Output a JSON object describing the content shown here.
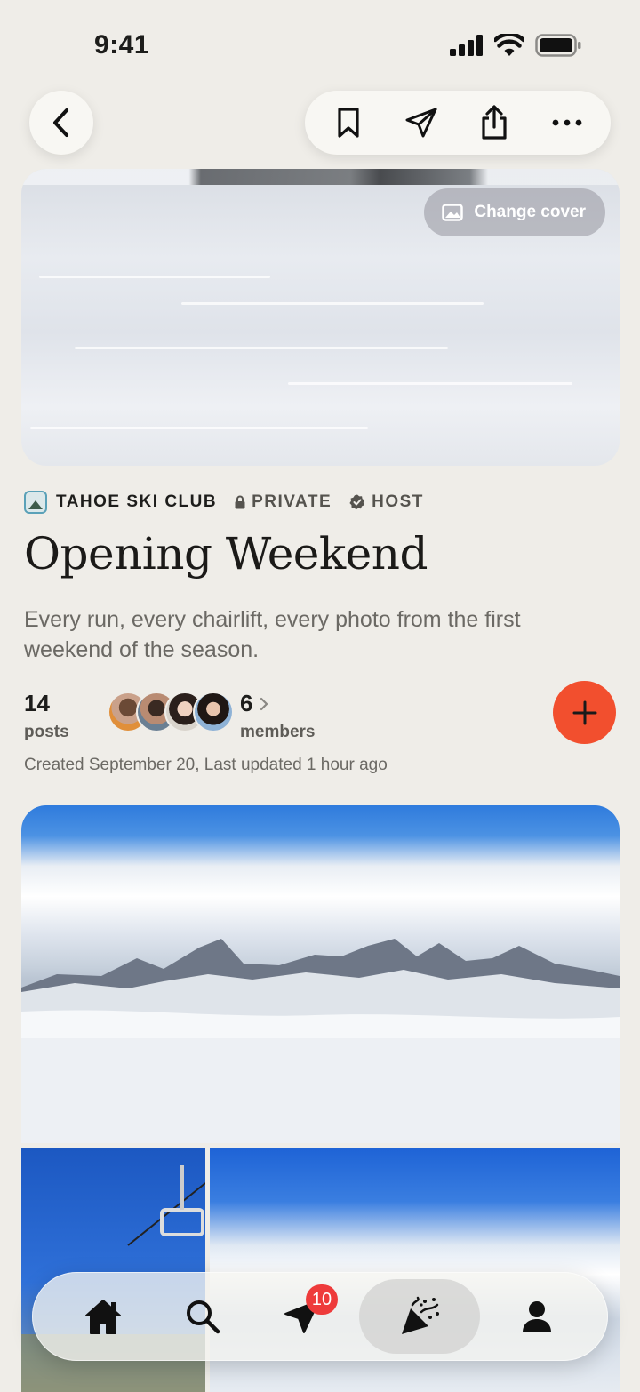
{
  "status_bar": {
    "time": "9:41"
  },
  "top_nav": {
    "back_icon": "chevron-left-icon",
    "actions": [
      "bookmark-icon",
      "send-icon",
      "share-icon",
      "more-icon"
    ]
  },
  "cover": {
    "change_cover_label": "Change cover"
  },
  "album": {
    "club_name": "TAHOE SKI CLUB",
    "privacy_label": "PRIVATE",
    "role_label": "HOST",
    "title": "Opening Weekend",
    "description": "Every run, every chairlift, every photo from the first weekend of the season.",
    "posts_count": "14",
    "posts_label": "posts",
    "members_count": "6",
    "members_label": "members",
    "created_text": "Created September 20, Last updated 1 hour ago"
  },
  "colors": {
    "accent": "#F24F2E",
    "badge": "#EE3B3B",
    "background": "#EFEDE8"
  },
  "tab_bar": {
    "tabs": [
      "home-icon",
      "search-icon",
      "send-icon",
      "party-popper-icon",
      "profile-icon"
    ],
    "active_tab": "party-popper-icon",
    "send_badge": "10"
  }
}
